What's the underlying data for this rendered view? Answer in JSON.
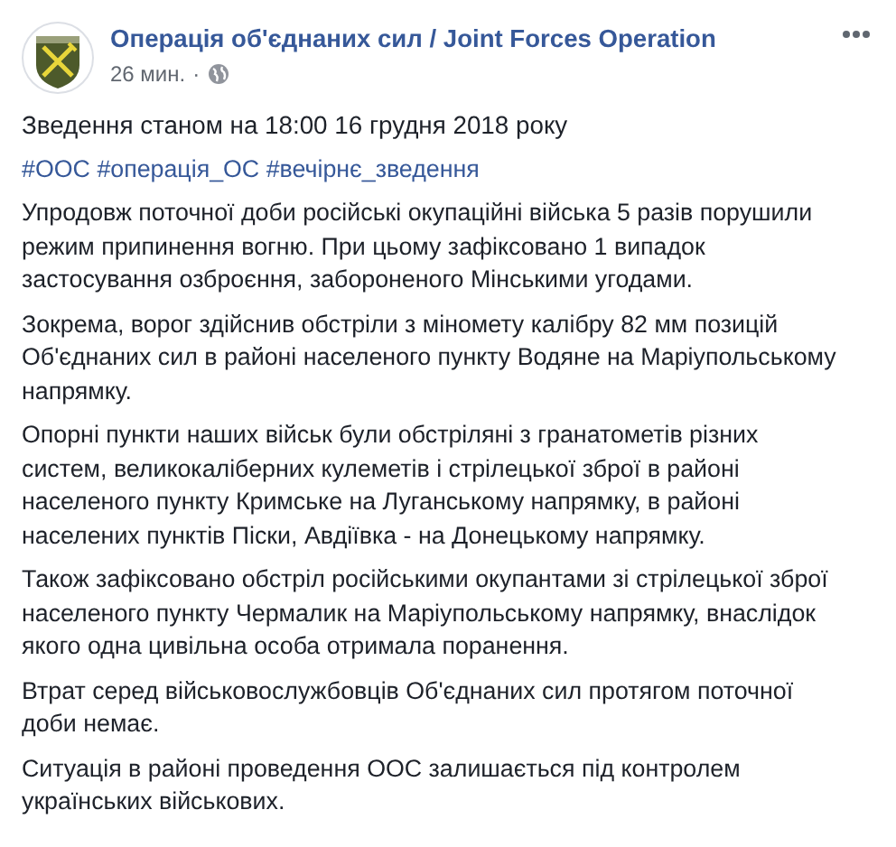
{
  "post": {
    "author": "Операція об'єднаних сил / Joint Forces Operation",
    "time": "26 мин.",
    "separator": "·",
    "paragraphs": [
      "Зведення станом на 18:00 16 грудня 2018 року"
    ],
    "hashtags": [
      "#ООС",
      "#операція_ОС",
      "#вечірнє_зведення"
    ],
    "body": [
      "Упродовж поточної доби російські окупаційні війська 5 разів порушили режим припинення вогню. При цьому зафіксовано 1 випадок застосування озброєння, забороненого Мінськими угодами.",
      "Зокрема, ворог здійснив обстріли з міномету калібру 82 мм позицій Об'єднаних сил в районі населеного пункту Водяне на Маріупольському напрямку.",
      "Опорні пункти наших військ були обстріляні з гранатометів різних систем, великокаліберних кулеметів і стрілецької зброї в районі населеного пункту Кримське на Луганському напрямку, в районі населених пунктів Піски, Авдіївка - на Донецькому напрямку.",
      "Також зафіксовано обстріл російськими окупантами зі стрілецької зброї населеного пункту Чермалик на Маріупольському напрямку, внаслідок якого одна цивільна особа отримала поранення.",
      "Втрат серед військовослужбовців Об'єднаних сил протягом поточної доби немає.",
      "Ситуація в районі проведення ООС залишається під контролем українських військових."
    ]
  }
}
